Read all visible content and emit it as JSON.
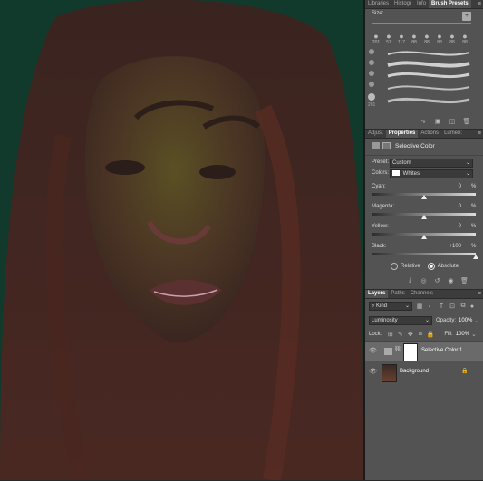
{
  "panels": {
    "brush_tabs": [
      "Libraries",
      "Histogr",
      "Info",
      "Brush Presets"
    ],
    "brush": {
      "size_label": "Size:",
      "preset_sizes": [
        "201",
        "51",
        "117",
        "88",
        "88",
        "88",
        "88",
        "88"
      ],
      "side_sizes": [
        "",
        "",
        "",
        "",
        "",
        "",
        "",
        "201"
      ]
    },
    "props_tabs": [
      "Adjust",
      "Properties",
      "Actions",
      "Lumen:"
    ],
    "properties": {
      "title": "Selective Color",
      "preset_label": "Preset:",
      "preset_value": "Custom",
      "colors_label": "Colors:",
      "colors_value": "Whites",
      "sliders": [
        {
          "label": "Cyan:",
          "value": "0",
          "unit": "%",
          "level": 0.5
        },
        {
          "label": "Magenta:",
          "value": "0",
          "unit": "%",
          "level": 0.5
        },
        {
          "label": "Yellow:",
          "value": "0",
          "unit": "%",
          "level": 0.5
        },
        {
          "label": "Black:",
          "value": "+100",
          "unit": "%",
          "level": 1.0
        }
      ],
      "relative_label": "Relative",
      "absolute_label": "Absolute"
    },
    "layers_tabs": [
      "Layers",
      "Paths",
      "Channels"
    ],
    "layers": {
      "kind_label": "Kind",
      "blend_mode": "Luminosity",
      "opacity_label": "Opacity:",
      "opacity_value": "100%",
      "lock_label": "Lock:",
      "fill_label": "Fill:",
      "fill_value": "100%",
      "items": [
        {
          "name": "Selective Color 1"
        },
        {
          "name": "Background"
        }
      ]
    }
  }
}
